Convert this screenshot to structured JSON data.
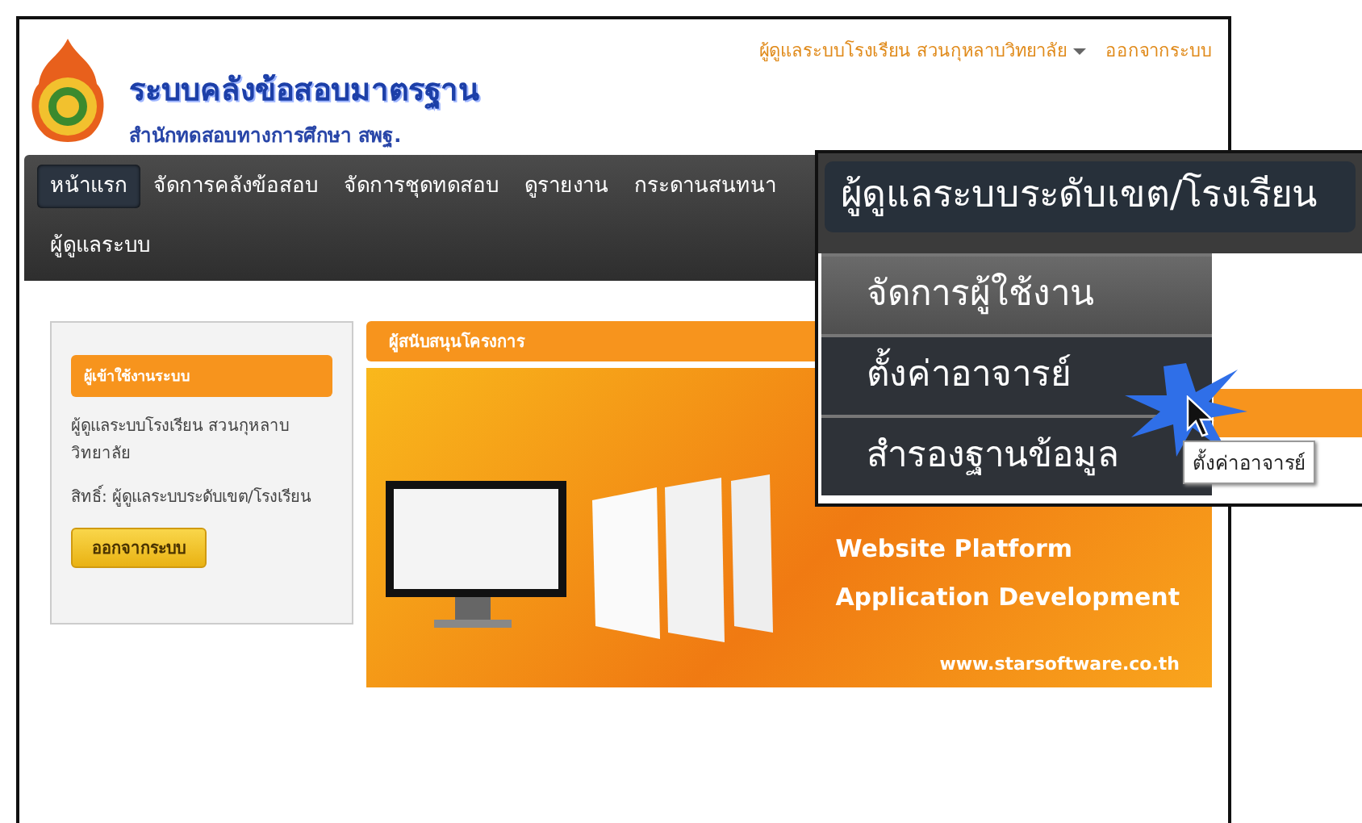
{
  "header": {
    "title": "ระบบคลังข้อสอบมาตรฐาน",
    "subtitle": "สำนักทดสอบทางการศึกษา สพฐ.",
    "user_menu": "ผู้ดูแลระบบโรงเรียน สวนกุหลาบวิทยาลัย",
    "logout_link": "ออกจากระบบ"
  },
  "nav": {
    "items": [
      {
        "label": "หน้าแรก",
        "selected": true
      },
      {
        "label": "จัดการคลังข้อสอบ",
        "selected": false
      },
      {
        "label": "จัดการชุดทดสอบ",
        "selected": false
      },
      {
        "label": "ดูรายงาน",
        "selected": false
      },
      {
        "label": "กระดานสนทนา",
        "selected": false
      },
      {
        "label": "ผู้ดูแลระบบ",
        "selected": false
      }
    ]
  },
  "login_panel": {
    "title": "ผู้เข้าใช้งานระบบ",
    "user": "ผู้ดูแลระบบโรงเรียน สวนกุหลาบวิทยาลัย",
    "role": "สิทธิ์: ผู้ดูแลระบบระดับเขต/โรงเรียน",
    "logout_button": "ออกจากระบบ"
  },
  "sponsor_panel": {
    "title": "ผู้สนับสนุนโครงการ",
    "banner_lines": [
      "Website Platform",
      "Application Development"
    ],
    "banner_url": "www.starsoftware.co.th"
  },
  "callout": {
    "menu_title": "ผู้ดูแลระบบระดับเขต/โรงเรียน",
    "items": [
      {
        "label": "จัดการผู้ใช้งาน",
        "highlighted": true
      },
      {
        "label": "ตั้งค่าอาจารย์",
        "highlighted": false
      },
      {
        "label": "สำรองฐานข้อมูล",
        "highlighted": false
      }
    ],
    "tooltip": "ตั้งค่าอาจารย์"
  }
}
